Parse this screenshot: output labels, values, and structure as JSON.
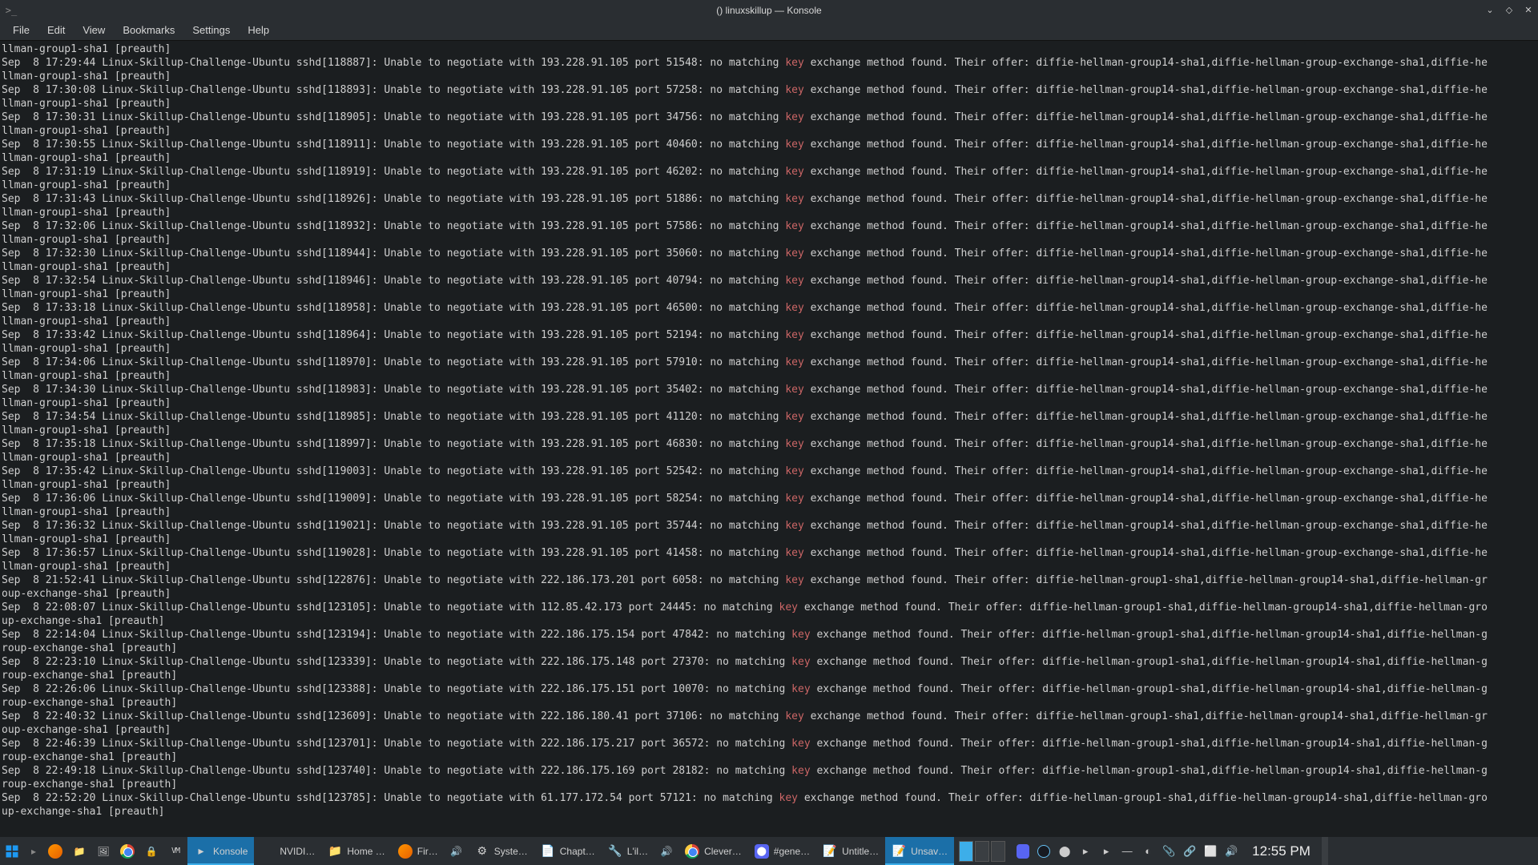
{
  "window": {
    "title": "() linuxskillup — Konsole",
    "controls": {
      "minimize": "⌄",
      "maximize": "◇",
      "close": "✕"
    }
  },
  "menu": [
    "File",
    "Edit",
    "View",
    "Bookmarks",
    "Settings",
    "Help"
  ],
  "terminal": {
    "highlight_word": "key",
    "lines": [
      {
        "line2": "llman-group1-sha1 [preauth]"
      },
      {
        "ts": "Sep  8 17:29:44",
        "pid": "118887",
        "ip": "193.228.91.105",
        "port": "51548",
        "tail": "diffie-hellman-group14-sha1,diffie-hellman-group-exchange-sha1,diffie-he",
        "line2": "llman-group1-sha1 [preauth]"
      },
      {
        "ts": "Sep  8 17:30:08",
        "pid": "118893",
        "ip": "193.228.91.105",
        "port": "57258",
        "tail": "diffie-hellman-group14-sha1,diffie-hellman-group-exchange-sha1,diffie-he",
        "line2": "llman-group1-sha1 [preauth]"
      },
      {
        "ts": "Sep  8 17:30:31",
        "pid": "118905",
        "ip": "193.228.91.105",
        "port": "34756",
        "tail": "diffie-hellman-group14-sha1,diffie-hellman-group-exchange-sha1,diffie-he",
        "line2": "llman-group1-sha1 [preauth]"
      },
      {
        "ts": "Sep  8 17:30:55",
        "pid": "118911",
        "ip": "193.228.91.105",
        "port": "40460",
        "tail": "diffie-hellman-group14-sha1,diffie-hellman-group-exchange-sha1,diffie-he",
        "line2": "llman-group1-sha1 [preauth]"
      },
      {
        "ts": "Sep  8 17:31:19",
        "pid": "118919",
        "ip": "193.228.91.105",
        "port": "46202",
        "tail": "diffie-hellman-group14-sha1,diffie-hellman-group-exchange-sha1,diffie-he",
        "line2": "llman-group1-sha1 [preauth]"
      },
      {
        "ts": "Sep  8 17:31:43",
        "pid": "118926",
        "ip": "193.228.91.105",
        "port": "51886",
        "tail": "diffie-hellman-group14-sha1,diffie-hellman-group-exchange-sha1,diffie-he",
        "line2": "llman-group1-sha1 [preauth]"
      },
      {
        "ts": "Sep  8 17:32:06",
        "pid": "118932",
        "ip": "193.228.91.105",
        "port": "57586",
        "tail": "diffie-hellman-group14-sha1,diffie-hellman-group-exchange-sha1,diffie-he",
        "line2": "llman-group1-sha1 [preauth]"
      },
      {
        "ts": "Sep  8 17:32:30",
        "pid": "118944",
        "ip": "193.228.91.105",
        "port": "35060",
        "tail": "diffie-hellman-group14-sha1,diffie-hellman-group-exchange-sha1,diffie-he",
        "line2": "llman-group1-sha1 [preauth]"
      },
      {
        "ts": "Sep  8 17:32:54",
        "pid": "118946",
        "ip": "193.228.91.105",
        "port": "40794",
        "tail": "diffie-hellman-group14-sha1,diffie-hellman-group-exchange-sha1,diffie-he",
        "line2": "llman-group1-sha1 [preauth]"
      },
      {
        "ts": "Sep  8 17:33:18",
        "pid": "118958",
        "ip": "193.228.91.105",
        "port": "46500",
        "tail": "diffie-hellman-group14-sha1,diffie-hellman-group-exchange-sha1,diffie-he",
        "line2": "llman-group1-sha1 [preauth]"
      },
      {
        "ts": "Sep  8 17:33:42",
        "pid": "118964",
        "ip": "193.228.91.105",
        "port": "52194",
        "tail": "diffie-hellman-group14-sha1,diffie-hellman-group-exchange-sha1,diffie-he",
        "line2": "llman-group1-sha1 [preauth]"
      },
      {
        "ts": "Sep  8 17:34:06",
        "pid": "118970",
        "ip": "193.228.91.105",
        "port": "57910",
        "tail": "diffie-hellman-group14-sha1,diffie-hellman-group-exchange-sha1,diffie-he",
        "line2": "llman-group1-sha1 [preauth]"
      },
      {
        "ts": "Sep  8 17:34:30",
        "pid": "118983",
        "ip": "193.228.91.105",
        "port": "35402",
        "tail": "diffie-hellman-group14-sha1,diffie-hellman-group-exchange-sha1,diffie-he",
        "line2": "llman-group1-sha1 [preauth]"
      },
      {
        "ts": "Sep  8 17:34:54",
        "pid": "118985",
        "ip": "193.228.91.105",
        "port": "41120",
        "tail": "diffie-hellman-group14-sha1,diffie-hellman-group-exchange-sha1,diffie-he",
        "line2": "llman-group1-sha1 [preauth]"
      },
      {
        "ts": "Sep  8 17:35:18",
        "pid": "118997",
        "ip": "193.228.91.105",
        "port": "46830",
        "tail": "diffie-hellman-group14-sha1,diffie-hellman-group-exchange-sha1,diffie-he",
        "line2": "llman-group1-sha1 [preauth]"
      },
      {
        "ts": "Sep  8 17:35:42",
        "pid": "119003",
        "ip": "193.228.91.105",
        "port": "52542",
        "tail": "diffie-hellman-group14-sha1,diffie-hellman-group-exchange-sha1,diffie-he",
        "line2": "llman-group1-sha1 [preauth]"
      },
      {
        "ts": "Sep  8 17:36:06",
        "pid": "119009",
        "ip": "193.228.91.105",
        "port": "58254",
        "tail": "diffie-hellman-group14-sha1,diffie-hellman-group-exchange-sha1,diffie-he",
        "line2": "llman-group1-sha1 [preauth]"
      },
      {
        "ts": "Sep  8 17:36:32",
        "pid": "119021",
        "ip": "193.228.91.105",
        "port": "35744",
        "tail": "diffie-hellman-group14-sha1,diffie-hellman-group-exchange-sha1,diffie-he",
        "line2": "llman-group1-sha1 [preauth]"
      },
      {
        "ts": "Sep  8 17:36:57",
        "pid": "119028",
        "ip": "193.228.91.105",
        "port": "41458",
        "tail": "diffie-hellman-group14-sha1,diffie-hellman-group-exchange-sha1,diffie-he",
        "line2": "llman-group1-sha1 [preauth]"
      },
      {
        "ts": "Sep  8 21:52:41",
        "pid": "122876",
        "ip": "222.186.173.201",
        "port": "6058",
        "tail": "diffie-hellman-group1-sha1,diffie-hellman-group14-sha1,diffie-hellman-gr",
        "line2": "oup-exchange-sha1 [preauth]"
      },
      {
        "ts": "Sep  8 22:08:07",
        "pid": "123105",
        "ip": "112.85.42.173",
        "port": "24445",
        "tail": "diffie-hellman-group1-sha1,diffie-hellman-group14-sha1,diffie-hellman-gro",
        "line2": "up-exchange-sha1 [preauth]"
      },
      {
        "ts": "Sep  8 22:14:04",
        "pid": "123194",
        "ip": "222.186.175.154",
        "port": "47842",
        "tail": "diffie-hellman-group1-sha1,diffie-hellman-group14-sha1,diffie-hellman-g",
        "line2": "roup-exchange-sha1 [preauth]"
      },
      {
        "ts": "Sep  8 22:23:10",
        "pid": "123339",
        "ip": "222.186.175.148",
        "port": "27370",
        "tail": "diffie-hellman-group1-sha1,diffie-hellman-group14-sha1,diffie-hellman-g",
        "line2": "roup-exchange-sha1 [preauth]"
      },
      {
        "ts": "Sep  8 22:26:06",
        "pid": "123388",
        "ip": "222.186.175.151",
        "port": "10070",
        "tail": "diffie-hellman-group1-sha1,diffie-hellman-group14-sha1,diffie-hellman-g",
        "line2": "roup-exchange-sha1 [preauth]"
      },
      {
        "ts": "Sep  8 22:40:32",
        "pid": "123609",
        "ip": "222.186.180.41",
        "port": "37106",
        "tail": "diffie-hellman-group1-sha1,diffie-hellman-group14-sha1,diffie-hellman-gr",
        "line2": "oup-exchange-sha1 [preauth]"
      },
      {
        "ts": "Sep  8 22:46:39",
        "pid": "123701",
        "ip": "222.186.175.217",
        "port": "36572",
        "tail": "diffie-hellman-group1-sha1,diffie-hellman-group14-sha1,diffie-hellman-g",
        "line2": "roup-exchange-sha1 [preauth]"
      },
      {
        "ts": "Sep  8 22:49:18",
        "pid": "123740",
        "ip": "222.186.175.169",
        "port": "28182",
        "tail": "diffie-hellman-group1-sha1,diffie-hellman-group14-sha1,diffie-hellman-g",
        "line2": "roup-exchange-sha1 [preauth]"
      },
      {
        "ts": "Sep  8 22:52:20",
        "pid": "123785",
        "ip": "61.177.172.54",
        "port": "57121",
        "tail": "diffie-hellman-group1-sha1,diffie-hellman-group14-sha1,diffie-hellman-gro",
        "line2": "up-exchange-sha1 [preauth]"
      }
    ],
    "host": "Linux-Skillup-Challenge-Ubuntu",
    "proc": "sshd",
    "pre": "Unable to negotiate with",
    "mid1": "port",
    "mid2": ": no matching",
    "post": "exchange method found. Their offer:"
  },
  "panel": {
    "tasks": [
      {
        "name": "konsole",
        "label": "Konsole",
        "active": true,
        "icon": "▸"
      },
      {
        "name": "nvidia",
        "label": "NVIDI…",
        "icon": "◉",
        "iconClass": "nvidia-icon"
      },
      {
        "name": "home",
        "label": "Home …",
        "icon": "📁"
      },
      {
        "name": "firefox2",
        "label": "Fir…",
        "iconClass": "firefox-icon"
      },
      {
        "name": "volume1",
        "icon": "🔊",
        "iconOnly": true
      },
      {
        "name": "system",
        "label": "Syste…",
        "icon": "⚙"
      },
      {
        "name": "chapter",
        "label": "Chapt…",
        "icon": "📄"
      },
      {
        "name": "lil",
        "label": "L'il…",
        "icon": "🔧"
      },
      {
        "name": "volume2",
        "icon": "🔊",
        "iconOnly": true
      },
      {
        "name": "clever",
        "label": "Clever…",
        "iconClass": "chrome-icon"
      },
      {
        "name": "discord",
        "label": "#gene…",
        "iconClass": "discord-icon",
        "iconText": "⬤"
      },
      {
        "name": "untitled",
        "label": "Untitle…",
        "icon": "📝"
      },
      {
        "name": "unsaved",
        "label": "Unsav…",
        "icon": "📝",
        "active": true
      }
    ],
    "launchers": [
      {
        "name": "firefox",
        "iconClass": "firefox-icon"
      },
      {
        "name": "files",
        "icon": "📁"
      },
      {
        "name": "image",
        "icon": "🖼"
      },
      {
        "name": "chrome",
        "iconClass": "chrome-icon"
      },
      {
        "name": "padlock",
        "icon": "🔒"
      },
      {
        "name": "vm",
        "icon": "VM",
        "textIcon": true
      }
    ],
    "tray_icons": [
      "⬤",
      "▸",
      "▸",
      "—",
      "◐",
      "📎",
      "🔗",
      "⬜",
      "🔊"
    ],
    "clock": "12:55 PM"
  }
}
